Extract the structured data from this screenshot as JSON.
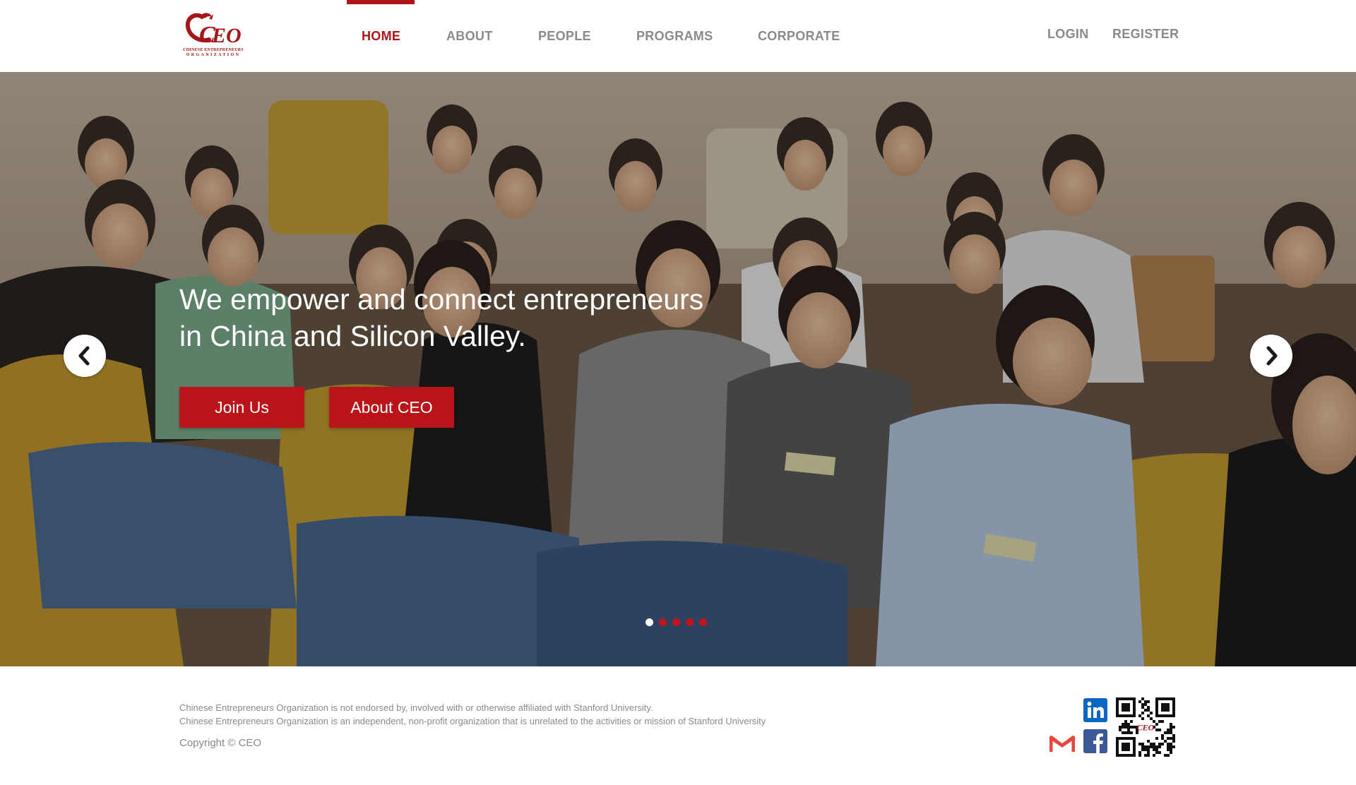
{
  "header": {
    "logo_text": "CEO",
    "logo_subtext_1": "CHINESE ENTREPRENEURS",
    "logo_subtext_2": "ORGANIZATION",
    "nav": [
      "HOME",
      "ABOUT",
      "PEOPLE",
      "PROGRAMS",
      "CORPORATE"
    ],
    "active_nav": "HOME",
    "login_label": "LOGIN",
    "register_label": "REGISTER"
  },
  "hero": {
    "headline_line1": "We empower and connect entrepreneurs",
    "headline_line2": "in China and Silicon Valley.",
    "join_button": "Join Us",
    "about_button": "About CEO",
    "prev_icon": "chevron-left-icon",
    "next_icon": "chevron-right-icon",
    "slide_count": 5,
    "active_slide": 1,
    "image_description": "audience-photo"
  },
  "footer": {
    "disclaimer_1": "Chinese Entrepreneurs Organization is not endorsed by, involved with or otherwise affiliated with Stanford University.",
    "disclaimer_2": "Chinese Entrepreneurs Organization is an independent, non-profit organization that is unrelated to the activities or mission of Stanford University",
    "copyright": "Copyright © CEO",
    "social": [
      "linkedin-icon",
      "gmail-icon",
      "facebook-icon",
      "wechat-qr-code"
    ]
  },
  "colors": {
    "brand_red": "#b0141b",
    "nav_gray": "#8a8a8a",
    "button_red": "#b81419",
    "linkedin_blue": "#0a66c2",
    "facebook_blue": "#3b5998"
  }
}
